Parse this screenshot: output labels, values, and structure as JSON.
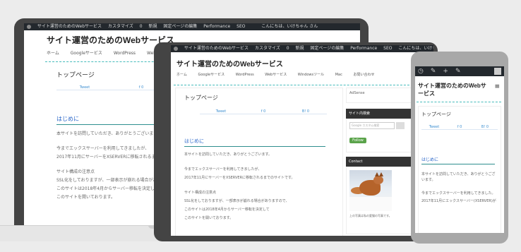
{
  "wpbar": {
    "site": "サイト運営のためのWebサービス",
    "customize": "カスタマイズ",
    "comments": "0",
    "new": "新規",
    "edit": "固定ページの編集",
    "performance": "Performance",
    "seo": "SEO",
    "greeting": "こんにちは、いけちゃん さん"
  },
  "site": {
    "title": "サイト運営のためのWebサービス",
    "nav": [
      "ホーム",
      "Googleサービス",
      "WordPress",
      "Webサービス",
      "Windowsツール",
      "Mac",
      "お問い合わせ"
    ]
  },
  "page": {
    "section_title": "トップページ",
    "share": [
      "Tweet",
      "f 0",
      "B! 0"
    ],
    "heading": "はじめに",
    "paragraphs": [
      "本サイトを訪問していただき、ありがとうございます。",
      "今までエックスサーバーを利用してきましたが、",
      "2017年11月にサーバーをXSERVERに移転されるまでのサイトです。",
      "サイト構成の注意点",
      "SSL化をしておりますが、一部表示が崩れる場合がありますので、",
      "このサイトは2018年4月からサーバー移転を決定して",
      "このサイトを開いております。"
    ]
  },
  "sidebar": {
    "adsense": "AdSense",
    "search_title": "サイト内検索",
    "search_placeholder": "Google カスタム検索",
    "follow": "Follow",
    "contact_title": "Contact",
    "caption": "上の写真は私の愛猫の写真です。"
  },
  "phone": {
    "title": "サイト運営のためのWebサービス",
    "section_title": "トップページ",
    "share": [
      "Tweet",
      "f 0",
      "B! 0"
    ],
    "heading": "はじめに",
    "paragraphs": [
      "本サイトを訪問していただき、ありがとうございます。",
      "今までエックスサーバーを利用してきました。",
      "2017年11月にエックスサーバー(XSERVER)が"
    ]
  },
  "colors": {
    "wpbar": "#23282d",
    "accent": "#2563c8",
    "teal": "#2f8f8f",
    "device": "#444444"
  }
}
